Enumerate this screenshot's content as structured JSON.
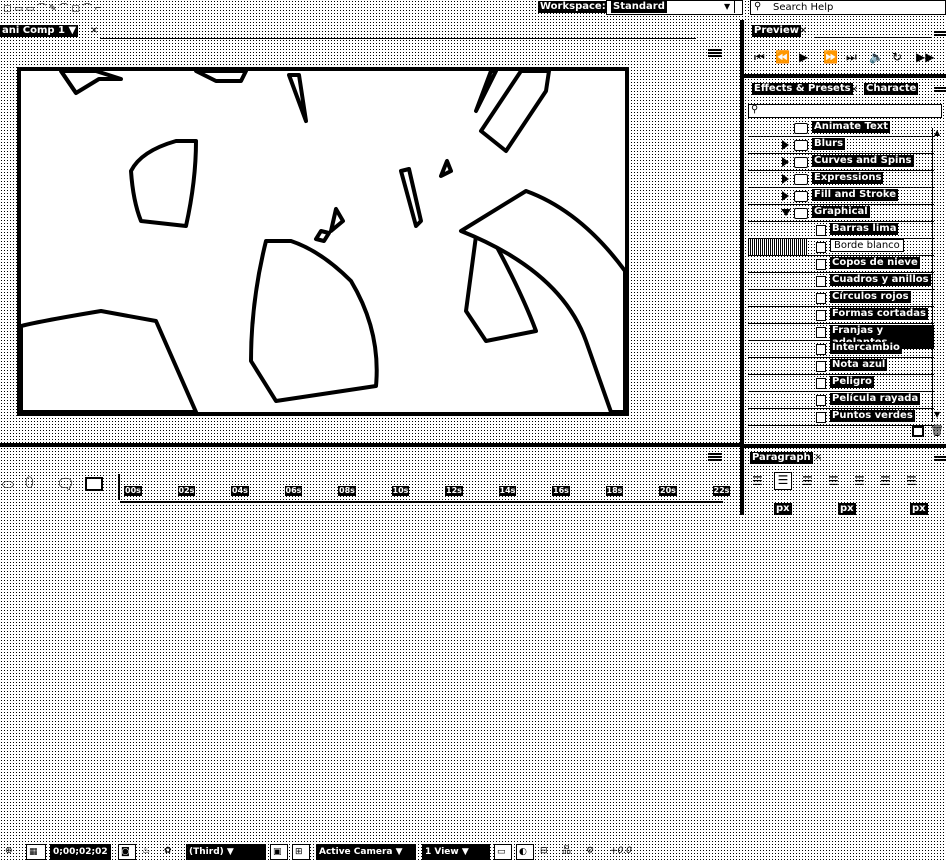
{
  "topbar": {
    "workspace_label": "Workspace:",
    "workspace_value": "Standard",
    "search_placeholder": "Search Help"
  },
  "comp_panel": {
    "tab_label": "ani Comp 1",
    "toolbar": {
      "timecode": "0;00;02;02",
      "resolution": "Third",
      "camera": "Active Camera",
      "views": "1 View"
    }
  },
  "preview_panel": {
    "tab_label": "Preview"
  },
  "effects_panel": {
    "tab_label": "Effects & Presets",
    "tab2_label": "Characte",
    "items": [
      {
        "label": "Animate Text",
        "kind": "folder",
        "level": 0,
        "state": "none"
      },
      {
        "label": "Blurs",
        "kind": "folder",
        "level": 0,
        "state": "collapsed"
      },
      {
        "label": "Curves and Spins",
        "kind": "folder",
        "level": 0,
        "state": "collapsed"
      },
      {
        "label": "Expressions",
        "kind": "folder",
        "level": 0,
        "state": "collapsed"
      },
      {
        "label": "Fill and Stroke",
        "kind": "folder",
        "level": 0,
        "state": "collapsed"
      },
      {
        "label": "Graphical",
        "kind": "folder",
        "level": 0,
        "state": "expanded"
      },
      {
        "label": "Barras lima",
        "kind": "preset",
        "level": 1,
        "state": "none"
      },
      {
        "label": "Borde blanco",
        "kind": "preset",
        "level": 1,
        "state": "selected"
      },
      {
        "label": "Copos de nieve",
        "kind": "preset",
        "level": 1,
        "state": "none"
      },
      {
        "label": "Cuadros y anillos",
        "kind": "preset",
        "level": 1,
        "state": "none"
      },
      {
        "label": "Círculos rojos",
        "kind": "preset",
        "level": 1,
        "state": "none"
      },
      {
        "label": "Formas cortadas",
        "kind": "preset",
        "level": 1,
        "state": "none"
      },
      {
        "label": "Franjas y adelantes",
        "kind": "preset",
        "level": 1,
        "state": "none"
      },
      {
        "label": "Intercambio",
        "kind": "preset",
        "level": 1,
        "state": "none"
      },
      {
        "label": "Nota azul",
        "kind": "preset",
        "level": 1,
        "state": "none"
      },
      {
        "label": "Peligro",
        "kind": "preset",
        "level": 1,
        "state": "none"
      },
      {
        "label": "Película rayada",
        "kind": "preset",
        "level": 1,
        "state": "none"
      },
      {
        "label": "Puntos verdes",
        "kind": "preset",
        "level": 1,
        "state": "none"
      }
    ]
  },
  "paragraph_panel": {
    "tab_label": "Paragraph",
    "unit": "px"
  },
  "timeline": {
    "ruler_labels": [
      "00s",
      "02s",
      "04s",
      "06s",
      "08s",
      "10s",
      "12s",
      "14s",
      "16s",
      "18s",
      "20s",
      "22s"
    ]
  }
}
